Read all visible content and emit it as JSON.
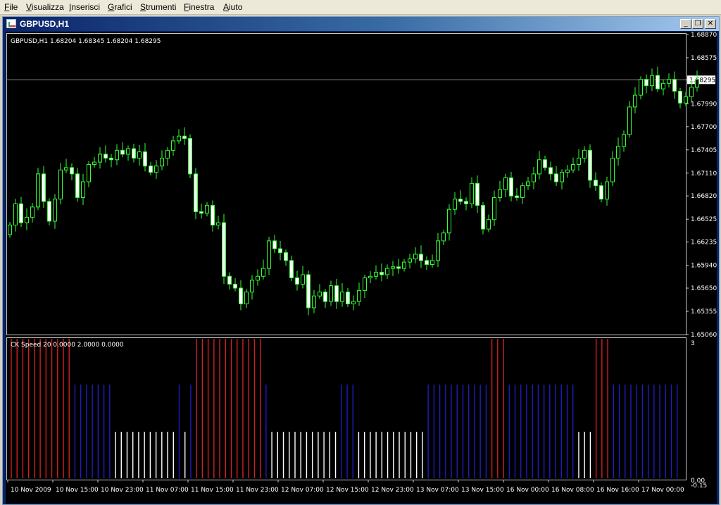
{
  "menu": [
    {
      "label": "File",
      "u": "F",
      "rest": "ile"
    },
    {
      "label": "Visualizza",
      "u": "V",
      "rest": "isualizza"
    },
    {
      "label": "Inserisci",
      "u": "I",
      "rest": "nserisci"
    },
    {
      "label": "Grafici",
      "u": "G",
      "rest": "rafici"
    },
    {
      "label": "Strumenti",
      "u": "S",
      "rest": "trumenti"
    },
    {
      "label": "Finestra",
      "u": "F",
      "rest": "inestra"
    },
    {
      "label": "Aiuto",
      "u": "A",
      "rest": "iuto"
    }
  ],
  "window": {
    "title": "GBPUSD,H1",
    "minimize_glyph": "_",
    "restore_glyph": "❐",
    "close_glyph": "✕"
  },
  "colors": {
    "background": "#000000",
    "candle_wick": "#33ff33",
    "candle_bull": "#000000",
    "candle_bear": "#ffffff",
    "bar_red": "#d22020",
    "bar_blue": "#1e1ebe",
    "bar_white": "#ffffff",
    "price_line": "#8a8a8a"
  },
  "chart_data": [
    {
      "type": "candlestick",
      "symbol_info": "GBPUSD,H1  1.68204 1.68345 1.68204 1.68295",
      "current_price": "1.68295",
      "current_price_value": 1.68295,
      "ylim": [
        1.6506,
        1.6887
      ],
      "y_ticks": [
        "1.68870",
        "1.68575",
        "1.68295",
        "1.67990",
        "1.67700",
        "1.67405",
        "1.67110",
        "1.66820",
        "1.66525",
        "1.66235",
        "1.65940",
        "1.65650",
        "1.65355",
        "1.65060"
      ],
      "y_tick_values": [
        1.6887,
        1.68575,
        1.68295,
        1.6799,
        1.677,
        1.67405,
        1.6711,
        1.6682,
        1.66525,
        1.66235,
        1.6594,
        1.6565,
        1.65355,
        1.6506
      ],
      "x_labels": [
        "10 Nov 2009",
        "10 Nov 15:00",
        "10 Nov 23:00",
        "11 Nov 07:00",
        "11 Nov 15:00",
        "11 Nov 23:00",
        "12 Nov 07:00",
        "12 Nov 15:00",
        "12 Nov 23:00",
        "13 Nov 07:00",
        "13 Nov 15:00",
        "16 Nov 00:00",
        "16 Nov 08:00",
        "16 Nov 16:00",
        "17 Nov 00:00"
      ],
      "closes": [
        1.6645,
        1.6672,
        1.6648,
        1.6655,
        1.6668,
        1.671,
        1.6675,
        1.665,
        1.6678,
        1.6715,
        1.6718,
        1.671,
        1.668,
        1.67,
        1.6722,
        1.6725,
        1.6735,
        1.673,
        1.6728,
        1.674,
        1.6735,
        1.6742,
        1.673,
        1.6738,
        1.672,
        1.6712,
        1.672,
        1.673,
        1.674,
        1.6752,
        1.6758,
        1.6755,
        1.671,
        1.6662,
        1.666,
        1.667,
        1.6645,
        1.6648,
        1.658,
        1.657,
        1.6565,
        1.6545,
        1.656,
        1.6575,
        1.658,
        1.659,
        1.6625,
        1.6615,
        1.661,
        1.66,
        1.6578,
        1.657,
        1.6582,
        1.654,
        1.6555,
        1.656,
        1.6548,
        1.6568,
        1.6548,
        1.656,
        1.6545,
        1.6548,
        1.6562,
        1.6578,
        1.658,
        1.6585,
        1.6582,
        1.659,
        1.6592,
        1.659,
        1.6598,
        1.6602,
        1.6608,
        1.66,
        1.6595,
        1.66,
        1.6625,
        1.6635,
        1.6665,
        1.6678,
        1.6675,
        1.6672,
        1.6698,
        1.667,
        1.664,
        1.6652,
        1.668,
        1.669,
        1.6705,
        1.6682,
        1.668,
        1.6695,
        1.67,
        1.671,
        1.6728,
        1.6718,
        1.671,
        1.67,
        1.6712,
        1.6715,
        1.6722,
        1.673,
        1.674,
        1.6702,
        1.6695,
        1.6678,
        1.67,
        1.673,
        1.6745,
        1.676,
        1.6795,
        1.681,
        1.683,
        1.6822,
        1.6835,
        1.6818,
        1.6825,
        1.683,
        1.6815,
        1.68,
        1.6808,
        1.682,
        1.683
      ],
      "indicator": {
        "label": "CK Speed 20 0.0000 2.0000 0.0000",
        "y_top_label": "3",
        "y_bottom_labels": [
          "0.00",
          "-0.15"
        ],
        "levels": [
          3,
          3,
          3,
          3,
          3,
          3,
          3,
          3,
          3,
          3,
          3,
          2,
          2,
          2,
          2,
          2,
          2,
          2,
          1,
          1,
          1,
          1,
          1,
          1,
          1,
          1,
          1,
          1,
          1,
          2,
          1,
          2,
          3,
          3,
          3,
          3,
          3,
          3,
          3,
          3,
          3,
          3,
          3,
          3,
          2,
          1,
          1,
          1,
          1,
          1,
          1,
          1,
          1,
          1,
          1,
          1,
          1,
          2,
          2,
          2,
          1,
          1,
          1,
          1,
          1,
          1,
          1,
          1,
          1,
          1,
          1,
          1,
          2,
          2,
          2,
          2,
          2,
          2,
          2,
          2,
          2,
          2,
          2,
          3,
          3,
          3,
          2,
          2,
          2,
          2,
          2,
          2,
          2,
          2,
          2,
          2,
          2,
          2,
          1,
          1,
          1,
          3,
          3,
          3,
          2,
          2,
          2,
          2,
          2,
          2,
          2,
          2,
          2,
          2,
          2,
          2
        ]
      }
    }
  ]
}
